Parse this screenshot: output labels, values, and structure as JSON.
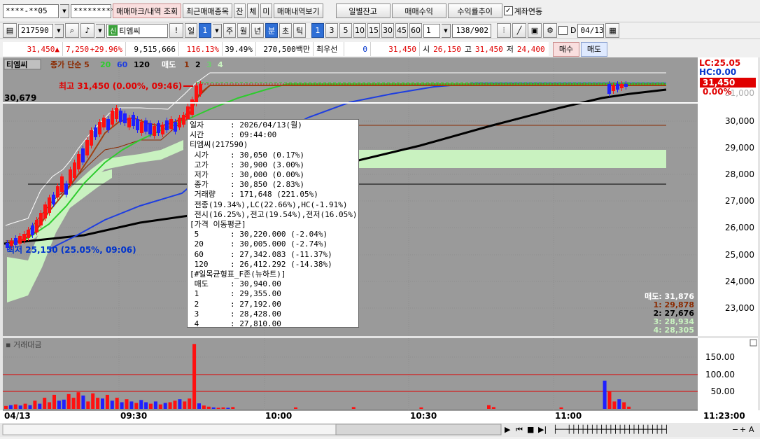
{
  "toolbar1": {
    "account": "****-**05",
    "password": "*********",
    "buttons": [
      "매매마크/내역 조회",
      "최근매매종목",
      "잔",
      "체",
      "미",
      "매매내역보기"
    ],
    "right_buttons": [
      "일별잔고",
      "매매수익",
      "수익률추이"
    ],
    "account_link_label": "계좌연동",
    "account_link_checked": "✓"
  },
  "toolbar2": {
    "code": "217590",
    "credit_badge": "신",
    "stock_name": "티엠씨",
    "warn": "!",
    "period_label": "일",
    "period_value": "1",
    "periods": [
      "주",
      "월",
      "년",
      "분",
      "초",
      "틱"
    ],
    "intervals": [
      "1",
      "3",
      "5",
      "10",
      "15",
      "30",
      "45",
      "60"
    ],
    "interval_value": "1",
    "count": "138/902",
    "d_label": "D",
    "date": "04/13"
  },
  "quote": {
    "price": "31,450",
    "arrow": "▲",
    "change": "7,250",
    "change_pct": "+29.96%",
    "volume": "9,515,666",
    "volume_ratio": "116.13%",
    "turnover_pct": "39.49%",
    "amount": "270,500백만",
    "priority_label": "최우선",
    "priority_value": "0",
    "priority_price": "31,450",
    "open_label": "시",
    "open": "26,150",
    "high_label": "고",
    "high": "31,450",
    "low_label": "저",
    "low": "24,400",
    "buy_label": "매수",
    "sell_label": "매도"
  },
  "legend": {
    "stock": "티엠씨",
    "ma_title": "종가 단순 5",
    "ma20": "20",
    "ma60": "60",
    "ma120": "120",
    "ichimoku": "매도",
    "ich1": "1",
    "ich2": "2",
    "ich3": "3",
    "ich4": "4"
  },
  "annotations": {
    "high_text": "최고 31,450 (0.00%, 09:46)",
    "low_text": "최저 25,150 (25.05%, 09:06)",
    "crosshair_price": "30,679",
    "lc": "LC:25.05",
    "hc": "HC:0.00",
    "current_price": "31,450",
    "current_pct": "0.00%",
    "sell_label": "매도: 31,876",
    "ich_labels": [
      "1: 29,878",
      "2: 27,676",
      "3: 28,934",
      "4: 28,305"
    ]
  },
  "price_axis": [
    "30,000",
    "29,000",
    "28,000",
    "27,000",
    "26,000",
    "25,000",
    "24,000",
    "23,000"
  ],
  "volume_panel": {
    "title": "거래대금",
    "axis": [
      "150.00",
      "100.00",
      "50.00"
    ]
  },
  "time_axis": {
    "labels": [
      "04/13",
      "09:30",
      "10:00",
      "10:30",
      "11:00"
    ],
    "current_time": "11:23:00"
  },
  "tooltip": {
    "rows": [
      {
        "k": "일자",
        "v": ": 2026/04/13(월)"
      },
      {
        "k": "시간",
        "v": ": 09:44:00"
      },
      {
        "k": "",
        "v": "티엠씨(217590)"
      },
      {
        "k": " 시가",
        "v": ": 30,050 (0.17%)"
      },
      {
        "k": " 고가",
        "v": ": 30,900 (3.00%)"
      },
      {
        "k": " 저가",
        "v": ": 30,000 (0.00%)"
      },
      {
        "k": " 종가",
        "v": ": 30,850 (2.83%)"
      },
      {
        "k": " 거래량",
        "v": ": 171,648 (221.05%)"
      },
      {
        "k": "",
        "v": " 전종(19.34%),LC(22.66%),HC(-1.91%)"
      },
      {
        "k": "",
        "v": " 전시(16.25%),전고(19.54%),전저(16.05%)"
      },
      {
        "k": "",
        "v": "[가격 이동평균]"
      },
      {
        "k": " 5",
        "v": ": 30,220.000 (-2.04%)"
      },
      {
        "k": " 20",
        "v": ": 30,005.000 (-2.74%)"
      },
      {
        "k": " 60",
        "v": ": 27,342.083 (-11.37%)"
      },
      {
        "k": " 120",
        "v": ": 26,412.292 (-14.38%)"
      },
      {
        "k": "",
        "v": "[#일목균형표_F존(뉴하트)]"
      },
      {
        "k": " 매도",
        "v": ": 30,940.00"
      },
      {
        "k": " 1",
        "v": ": 29,355.00"
      },
      {
        "k": " 2",
        "v": ": 27,192.00"
      },
      {
        "k": " 3",
        "v": ": 28,428.00"
      },
      {
        "k": " 4",
        "v": ": 27,810.00"
      }
    ]
  },
  "chart_data": {
    "type": "candlestick",
    "price_ylim": [
      22400,
      32200
    ],
    "volume_ylim": [
      0,
      185
    ],
    "volume_unit": "거래대금",
    "volume_bars": [
      {
        "i": 0,
        "v": 8,
        "c": "r"
      },
      {
        "i": 1,
        "v": 10,
        "c": "b"
      },
      {
        "i": 2,
        "v": 12,
        "c": "r"
      },
      {
        "i": 3,
        "v": 9,
        "c": "b"
      },
      {
        "i": 4,
        "v": 14,
        "c": "r"
      },
      {
        "i": 5,
        "v": 10,
        "c": "b"
      },
      {
        "i": 6,
        "v": 22,
        "c": "r"
      },
      {
        "i": 7,
        "v": 14,
        "c": "b"
      },
      {
        "i": 8,
        "v": 30,
        "c": "r"
      },
      {
        "i": 9,
        "v": 18,
        "c": "r"
      },
      {
        "i": 10,
        "v": 38,
        "c": "r"
      },
      {
        "i": 11,
        "v": 22,
        "c": "b"
      },
      {
        "i": 12,
        "v": 25,
        "c": "b"
      },
      {
        "i": 13,
        "v": 40,
        "c": "r"
      },
      {
        "i": 14,
        "v": 30,
        "c": "r"
      },
      {
        "i": 15,
        "v": 45,
        "c": "r"
      },
      {
        "i": 16,
        "v": 36,
        "c": "b"
      },
      {
        "i": 17,
        "v": 20,
        "c": "r"
      },
      {
        "i": 18,
        "v": 42,
        "c": "r"
      },
      {
        "i": 19,
        "v": 30,
        "c": "r"
      },
      {
        "i": 20,
        "v": 28,
        "c": "b"
      },
      {
        "i": 21,
        "v": 38,
        "c": "r"
      },
      {
        "i": 22,
        "v": 22,
        "c": "b"
      },
      {
        "i": 23,
        "v": 30,
        "c": "r"
      },
      {
        "i": 24,
        "v": 18,
        "c": "b"
      },
      {
        "i": 25,
        "v": 26,
        "c": "r"
      },
      {
        "i": 26,
        "v": 20,
        "c": "b"
      },
      {
        "i": 27,
        "v": 16,
        "c": "r"
      },
      {
        "i": 28,
        "v": 24,
        "c": "b"
      },
      {
        "i": 29,
        "v": 18,
        "c": "b"
      },
      {
        "i": 30,
        "v": 14,
        "c": "r"
      },
      {
        "i": 31,
        "v": 20,
        "c": "b"
      },
      {
        "i": 32,
        "v": 12,
        "c": "r"
      },
      {
        "i": 33,
        "v": 16,
        "c": "b"
      },
      {
        "i": 34,
        "v": 18,
        "c": "r"
      },
      {
        "i": 35,
        "v": 22,
        "c": "r"
      },
      {
        "i": 36,
        "v": 26,
        "c": "b"
      },
      {
        "i": 37,
        "v": 20,
        "c": "r"
      },
      {
        "i": 38,
        "v": 28,
        "c": "r"
      },
      {
        "i": 39,
        "v": 175,
        "c": "r"
      },
      {
        "i": 40,
        "v": 15,
        "c": "b"
      },
      {
        "i": 41,
        "v": 9,
        "c": "r"
      },
      {
        "i": 42,
        "v": 6,
        "c": "r"
      },
      {
        "i": 43,
        "v": 4,
        "c": "b"
      },
      {
        "i": 44,
        "v": 3,
        "c": "r"
      },
      {
        "i": 45,
        "v": 4,
        "c": "r"
      },
      {
        "i": 46,
        "v": 3,
        "c": "b"
      },
      {
        "i": 47,
        "v": 5,
        "c": "r"
      },
      {
        "i": 60,
        "v": 4,
        "c": "r"
      },
      {
        "i": 72,
        "v": 5,
        "c": "r"
      },
      {
        "i": 86,
        "v": 4,
        "c": "r"
      },
      {
        "i": 100,
        "v": 10,
        "c": "r"
      },
      {
        "i": 101,
        "v": 5,
        "c": "r"
      },
      {
        "i": 115,
        "v": 4,
        "c": "r"
      },
      {
        "i": 124,
        "v": 76,
        "c": "b"
      },
      {
        "i": 125,
        "v": 46,
        "c": "r"
      },
      {
        "i": 126,
        "v": 20,
        "c": "r"
      },
      {
        "i": 127,
        "v": 26,
        "c": "b"
      },
      {
        "i": 128,
        "v": 18,
        "c": "r"
      },
      {
        "i": 129,
        "v": 6,
        "c": "r"
      }
    ]
  }
}
